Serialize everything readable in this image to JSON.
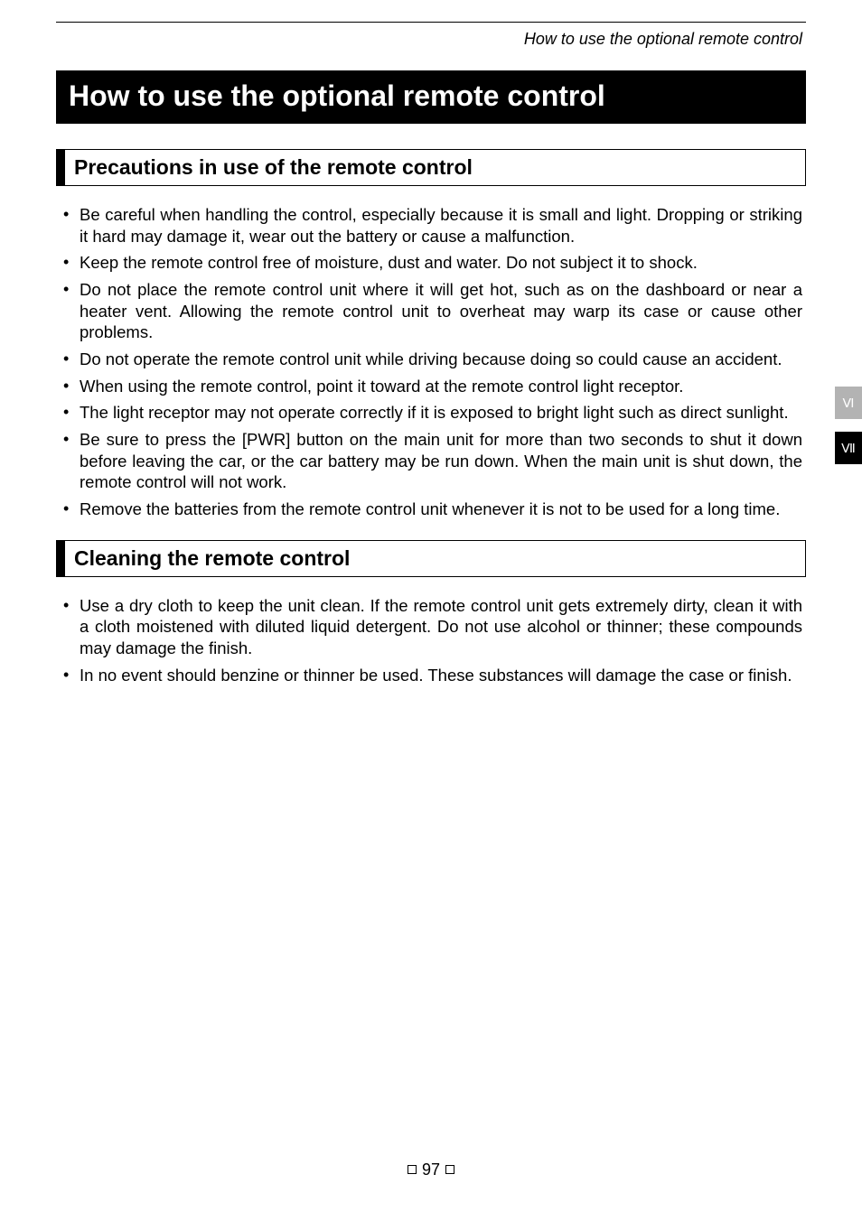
{
  "running_head": "How to use the optional remote control",
  "main_title": "How to use the optional remote control",
  "sections": {
    "precautions": {
      "title": "Precautions in use of the remote control",
      "items": [
        "Be careful when handling the control, especially because it is small and light. Dropping or striking it hard may damage it, wear out the battery or cause a malfunction.",
        "Keep the remote control free of moisture, dust and water. Do not subject it to shock.",
        "Do not place the remote control unit where it will get hot, such as on the dashboard or near a heater vent. Allowing the remote control unit to overheat may warp its case or cause other problems.",
        "Do not operate the remote control unit while driving because doing so could cause an accident.",
        "When using the remote control, point it toward at the remote control light receptor.",
        "The light receptor may not operate correctly if it is exposed to bright light such as direct sunlight.",
        "Be sure to press the [PWR] button on the main unit for more than two seconds to shut it down before leaving the car, or the car battery may be run down. When the main unit is shut down, the remote control will not work.",
        "Remove the batteries from the remote control unit whenever it is not to be used for a long time."
      ]
    },
    "cleaning": {
      "title": "Cleaning the remote control",
      "items": [
        "Use a dry cloth to keep the unit clean. If the remote control unit gets extremely dirty, clean it with a cloth moistened with diluted liquid detergent. Do not use alcohol or thinner; these compounds may damage the finish.",
        "In no event should benzine or thinner be used. These substances will damage the case or finish."
      ]
    }
  },
  "side_tabs": {
    "tab1": "Ⅵ",
    "tab2": "Ⅶ"
  },
  "page_number": "97"
}
